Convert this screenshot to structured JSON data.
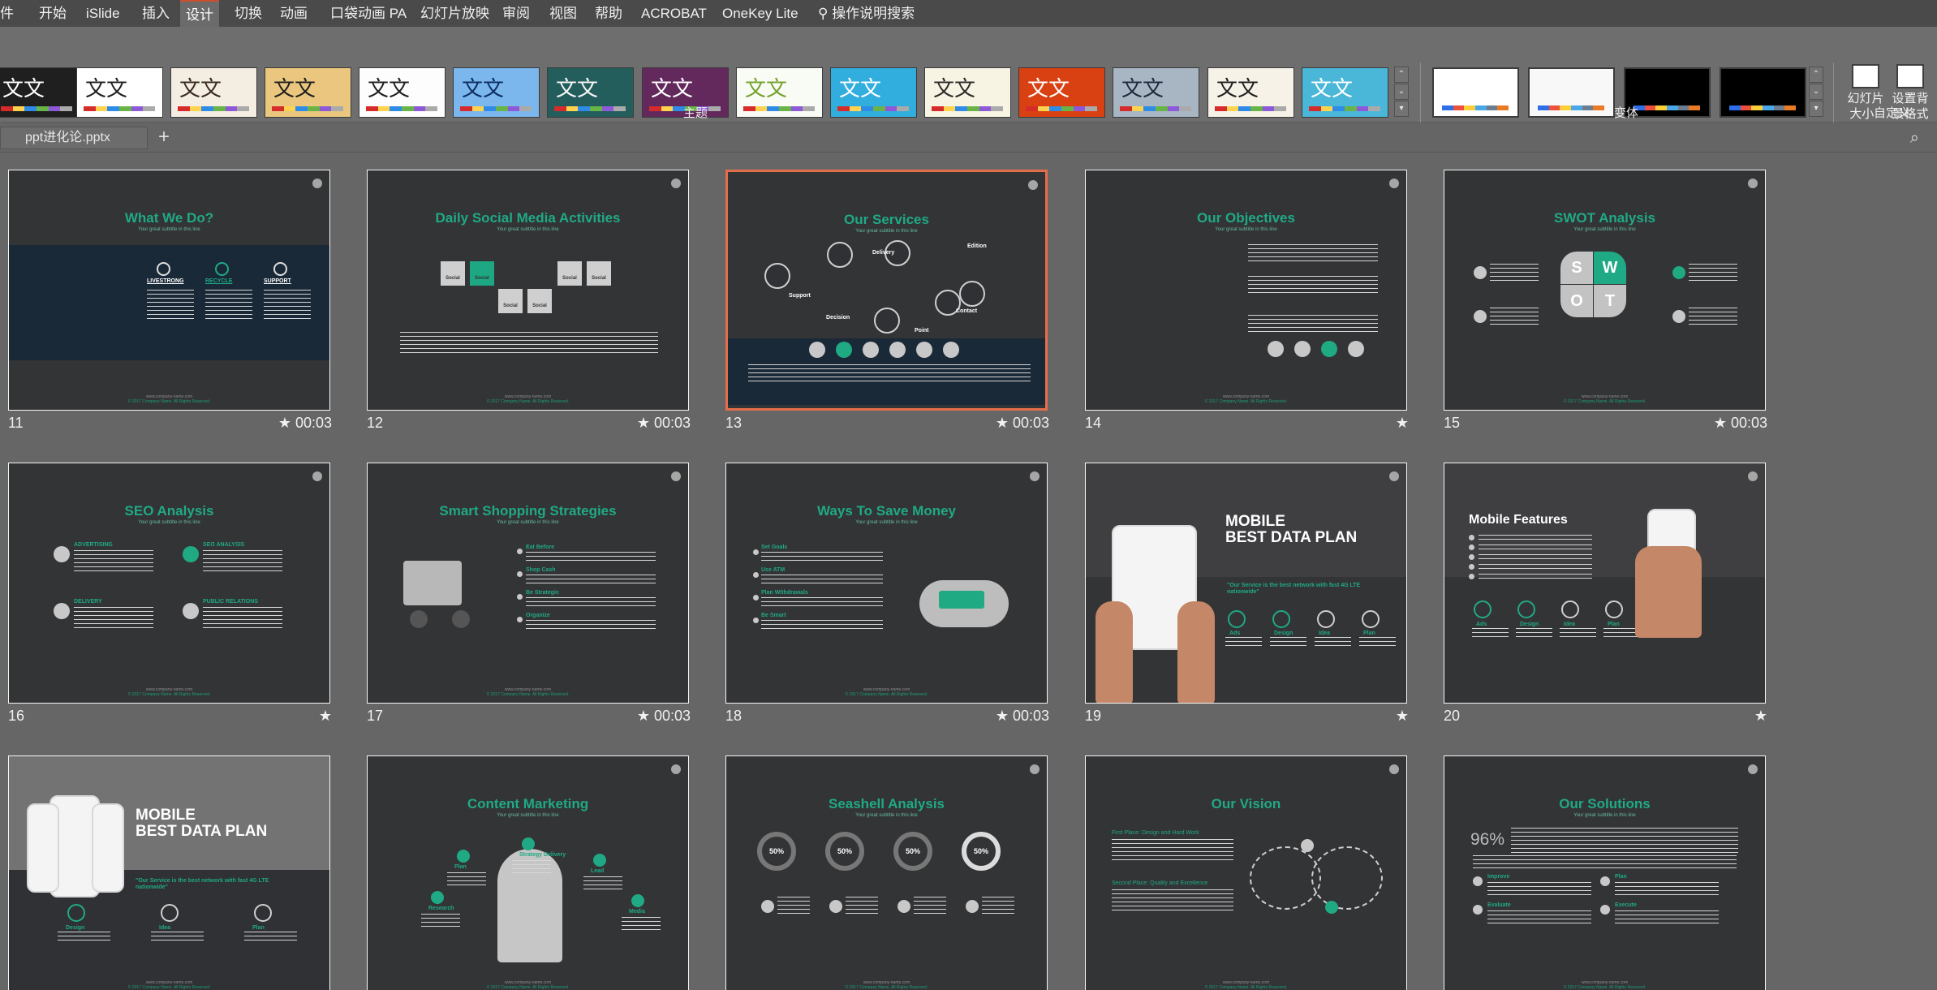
{
  "menu": {
    "items": [
      "件",
      "开始",
      "iSlide",
      "插入",
      "设计",
      "切换",
      "动画",
      "口袋动画 PA",
      "幻灯片放映",
      "审阅",
      "视图",
      "帮助",
      "ACROBAT",
      "OneKey Lite"
    ],
    "active": "设计",
    "tell_me": "操作说明搜索"
  },
  "ribbon": {
    "theme_label": "主题",
    "variant_label": "变体",
    "customize_label": "自定义",
    "theme_tile_text": "文文",
    "themes": [
      {
        "text": "文文",
        "bg": "#1f1f1f",
        "fg": "#ffffff"
      },
      {
        "text": "文文",
        "bg": "#ffffff",
        "fg": "#1f1f1f"
      },
      {
        "text": "文文",
        "bg": "#f3ede2",
        "fg": "#3a2a1e"
      },
      {
        "text": "文文",
        "bg": "#ebc67f",
        "fg": "#1e1e1e"
      },
      {
        "text": "文文",
        "bg": "#fdfdfd",
        "fg": "#1e1e1e"
      },
      {
        "text": "文文",
        "bg": "#7bb7ec",
        "fg": "#0d2d62"
      },
      {
        "text": "文文",
        "bg": "#245e5c",
        "fg": "#f7f7f7"
      },
      {
        "text": "文文",
        "bg": "#63295c",
        "fg": "#ffffff"
      },
      {
        "text": "文文",
        "bg": "#f9fbf5",
        "fg": "#74a32d"
      },
      {
        "text": "文文",
        "bg": "#32aede",
        "fg": "#ffffff"
      },
      {
        "text": "文文",
        "bg": "#f8f4e3",
        "fg": "#2b2b2b"
      },
      {
        "text": "文文",
        "bg": "#d94012",
        "fg": "#ffffff"
      },
      {
        "text": "文文",
        "bg": "#a8b6c4",
        "fg": "#1c2b3c"
      },
      {
        "text": "文文",
        "bg": "#f6f2e8",
        "fg": "#1e1e1e"
      },
      {
        "text": "文文",
        "bg": "#4ab7d8",
        "fg": "#ffffff"
      }
    ],
    "variants": [
      "#ffffff",
      "#f8f8f8",
      "#000000",
      "#000000"
    ],
    "size_button": "幻灯片\n大小 ·",
    "bg_button": "设置背\n景格式"
  },
  "tab": {
    "file_name": "ppt进化论.pptx",
    "new_tab": "+"
  },
  "slides": [
    {
      "num": "11",
      "time": "★ 00:03",
      "title": "What We Do?",
      "subtitle": "Your great subtitle in this line",
      "badges": [
        "LIVESTRONG",
        "RECYCLE",
        "SUPPORT"
      ]
    },
    {
      "num": "12",
      "time": "★ 00:03",
      "title": "Daily Social Media Activities",
      "subtitle": "Your great subtitle in this line",
      "badges": [
        "Social",
        "Social",
        "Social",
        "Social",
        "Social",
        "Social"
      ]
    },
    {
      "num": "13",
      "time": "★ 00:03",
      "title": "Our Services",
      "subtitle": "Your great subtitle in this line",
      "badges": [
        "Support",
        "Delivery",
        "Edition",
        "Decision",
        "Point",
        "Contact"
      ]
    },
    {
      "num": "14",
      "time": "★",
      "title": "Our Objectives",
      "subtitle": "Your great subtitle in this line",
      "badges": []
    },
    {
      "num": "15",
      "time": "★ 00:03",
      "title": "SWOT Analysis",
      "subtitle": "Your great subtitle in this line",
      "badges": [
        "S",
        "W",
        "O",
        "T"
      ]
    },
    {
      "num": "16",
      "time": "★",
      "title": "SEO Analysis",
      "subtitle": "Your great subtitle in this line",
      "badges": [
        "ADVERTISING",
        "SEO ANALYSIS",
        "DELIVERY",
        "PUBLIC RELATIONS"
      ]
    },
    {
      "num": "17",
      "time": "★ 00:03",
      "title": "Smart Shopping Strategies",
      "subtitle": "Your great subtitle in this line",
      "badges": [
        "Eat Before",
        "Shop Cash",
        "Be Strategic",
        "Organize"
      ]
    },
    {
      "num": "18",
      "time": "★ 00:03",
      "title": "Ways To Save Money",
      "subtitle": "Your great subtitle in this line",
      "badges": [
        "Set Goals",
        "Use ATM",
        "Plan Withdrawals",
        "Be Smart"
      ]
    },
    {
      "num": "19",
      "time": "★",
      "title": "MOBILE\nBEST DATA PLAN",
      "subtitle": "\"Our Service is the best network with fast 4G LTE nationwide\"",
      "badges": [
        "Ads",
        "Design",
        "Idea",
        "Plan"
      ]
    },
    {
      "num": "20",
      "time": "★",
      "title": "Mobile Features",
      "subtitle": "",
      "badges": [
        "Ads",
        "Design",
        "Idea",
        "Plan"
      ]
    },
    {
      "num": "",
      "time": "",
      "title": "MOBILE\nBEST DATA PLAN",
      "subtitle": "\"Our Service is the best network with fast 4G LTE nationwide\"",
      "badges": [
        "Design",
        "Idea",
        "Plan"
      ]
    },
    {
      "num": "",
      "time": "",
      "title": "Content Marketing",
      "subtitle": "Your great subtitle in this line",
      "badges": [
        "Plan",
        "Strategy Delivery",
        "Lead",
        "Research",
        "Media"
      ]
    },
    {
      "num": "",
      "time": "",
      "title": "Seashell Analysis",
      "subtitle": "Your great subtitle in this line",
      "badges": [
        "50%",
        "50%",
        "50%",
        "50%"
      ]
    },
    {
      "num": "",
      "time": "",
      "title": "Our Vision",
      "subtitle": "",
      "badges": [
        "First Place: Design and Hard Work",
        "Second Place: Quality and Excellence"
      ]
    },
    {
      "num": "",
      "time": "",
      "title": "Our Solutions",
      "subtitle": "Your great subtitle in this line",
      "badges": [
        "96%",
        "Improve",
        "Plan",
        "Evaluate",
        "Execute"
      ]
    }
  ]
}
